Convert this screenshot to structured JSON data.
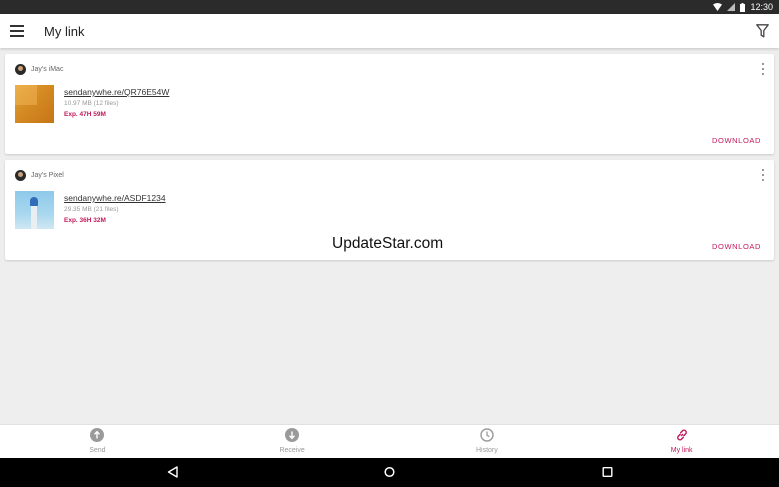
{
  "status_bar": {
    "time": "12:30"
  },
  "app_bar": {
    "title": "My link"
  },
  "links": [
    {
      "owner": "Jay's iMac",
      "url": "sendanywhe.re/QR76E54W",
      "size": "10.97 MB (12 files)",
      "expiry": "Exp. 47H 59M",
      "action": "DOWNLOAD"
    },
    {
      "owner": "Jay's Pixel",
      "url": "sendanywhe.re/ASDF1234",
      "size": "29.35 MB (21 files)",
      "expiry": "Exp. 36H 32M",
      "action": "DOWNLOAD"
    }
  ],
  "watermark": "UpdateStar.com",
  "bottom_nav": [
    {
      "label": "Send",
      "icon": "upload-circle-icon",
      "active": false
    },
    {
      "label": "Receive",
      "icon": "download-circle-icon",
      "active": false
    },
    {
      "label": "History",
      "icon": "clock-icon",
      "active": false
    },
    {
      "label": "My link",
      "icon": "link-icon",
      "active": true
    }
  ],
  "colors": {
    "accent": "#c2185b",
    "background": "#eeeeee",
    "status_bar": "#2b2b2b",
    "nav_inactive": "#9a9a9a"
  }
}
